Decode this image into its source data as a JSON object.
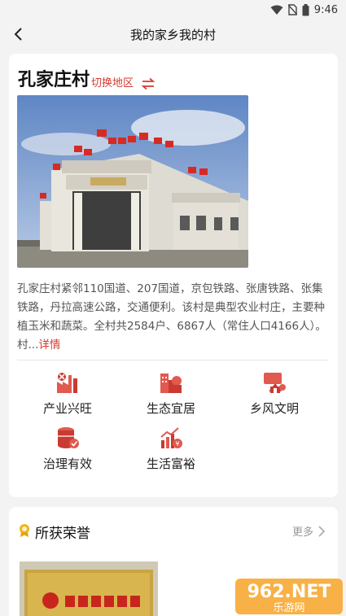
{
  "status": {
    "time": "9:46"
  },
  "nav": {
    "title": "我的家乡我的村"
  },
  "village": {
    "name": "孔家庄村",
    "switch_label": "切换地区",
    "description": "孔家庄村紧邻110国道、207国道，京包铁路、张唐铁路、张集铁路，丹拉高速公路，交通便利。该村是典型农业村庄，主要种植玉米和蔬菜。全村共2584户、6867人（常住人口4166人）。村...",
    "more_label": "详情"
  },
  "features": [
    {
      "label": "产业兴旺",
      "icon": "industry-icon"
    },
    {
      "label": "生态宜居",
      "icon": "eco-housing-icon"
    },
    {
      "label": "乡风文明",
      "icon": "civilization-icon"
    },
    {
      "label": "治理有效",
      "icon": "governance-icon"
    },
    {
      "label": "生活富裕",
      "icon": "prosperity-icon"
    }
  ],
  "honors": {
    "title": "所获荣誉",
    "more_label": "更多"
  },
  "watermark": {
    "text": "962.NET",
    "subtext": "乐游网"
  },
  "colors": {
    "accent": "#d63a2f",
    "background": "#f3f3f3"
  }
}
